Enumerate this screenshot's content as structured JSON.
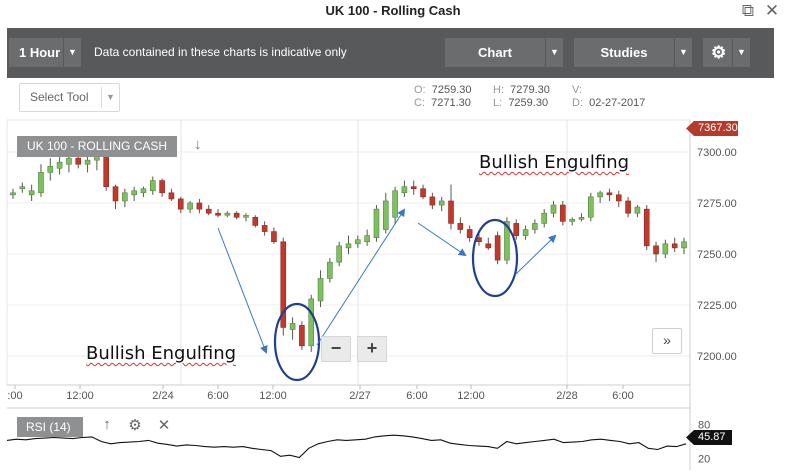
{
  "window": {
    "title": "UK 100 - Rolling Cash",
    "popout_icon": "popout-icon",
    "close_icon": "close-icon"
  },
  "toolbar": {
    "interval_label": "1 Hour",
    "notice": "Data contained in these charts is indicative only",
    "chart_label": "Chart",
    "studies_label": "Studies",
    "settings_icon": "gear-icon"
  },
  "select_tool": {
    "label": "Select Tool"
  },
  "ohlc": {
    "o_label": "O:",
    "o_value": "7259.30",
    "h_label": "H:",
    "h_value": "7279.30",
    "v_label": "V:",
    "v_value": "",
    "c_label": "C:",
    "c_value": "7271.30",
    "l_label": "L:",
    "l_value": "7259.30",
    "d_label": "D:",
    "d_value": "02-27-2017"
  },
  "instrument_label": "UK 100 - ROLLING CASH",
  "annotations": {
    "left": "Bullish Engulfing",
    "right": "Bullish Engulfing"
  },
  "zoom": {
    "minus": "−",
    "plus": "+"
  },
  "scroll_right": "»",
  "price_tag": "7367.30",
  "rsi": {
    "label": "RSI (14)",
    "value_tag": "45.87",
    "up_icon": "arrow-up-icon",
    "settings_icon": "gear-icon",
    "close_icon": "close-icon"
  },
  "colors": {
    "up": "#7fbf5f",
    "down": "#c0392b",
    "toolbar": "#58595b",
    "annotation": "#1f3f8f"
  },
  "chart_data": {
    "type": "candlestick",
    "title": "UK 100 - ROLLING CASH",
    "interval": "1 Hour",
    "y_ticks": [
      "7300.00",
      "7275.00",
      "7250.00",
      "7225.00",
      "7200.00"
    ],
    "ylim": [
      7190,
      7310
    ],
    "x_ticks": [
      ":00",
      "12:00",
      "2/24",
      "6:00",
      "12:00",
      "2/27",
      "6:00",
      "12:00",
      "2/28",
      "6:00"
    ],
    "candles": [
      {
        "o": 7279,
        "h": 7282,
        "l": 7277,
        "c": 7280
      },
      {
        "o": 7282,
        "h": 7285,
        "l": 7280,
        "c": 7283
      },
      {
        "o": 7279,
        "h": 7284,
        "l": 7276,
        "c": 7281
      },
      {
        "o": 7280,
        "h": 7294,
        "l": 7278,
        "c": 7290
      },
      {
        "o": 7290,
        "h": 7297,
        "l": 7286,
        "c": 7293
      },
      {
        "o": 7292,
        "h": 7298,
        "l": 7289,
        "c": 7295
      },
      {
        "o": 7294,
        "h": 7300,
        "l": 7290,
        "c": 7297
      },
      {
        "o": 7297,
        "h": 7302,
        "l": 7292,
        "c": 7294
      },
      {
        "o": 7294,
        "h": 7299,
        "l": 7290,
        "c": 7296
      },
      {
        "o": 7296,
        "h": 7306,
        "l": 7291,
        "c": 7300
      },
      {
        "o": 7300,
        "h": 7301,
        "l": 7281,
        "c": 7283
      },
      {
        "o": 7283,
        "h": 7284,
        "l": 7272,
        "c": 7276
      },
      {
        "o": 7276,
        "h": 7282,
        "l": 7273,
        "c": 7280
      },
      {
        "o": 7279,
        "h": 7283,
        "l": 7276,
        "c": 7281
      },
      {
        "o": 7280,
        "h": 7283,
        "l": 7278,
        "c": 7282
      },
      {
        "o": 7281,
        "h": 7288,
        "l": 7279,
        "c": 7286
      },
      {
        "o": 7286,
        "h": 7287,
        "l": 7278,
        "c": 7280
      },
      {
        "o": 7280,
        "h": 7282,
        "l": 7276,
        "c": 7277
      },
      {
        "o": 7277,
        "h": 7278,
        "l": 7270,
        "c": 7272
      },
      {
        "o": 7272,
        "h": 7276,
        "l": 7270,
        "c": 7275
      },
      {
        "o": 7275,
        "h": 7277,
        "l": 7270,
        "c": 7272
      },
      {
        "o": 7272,
        "h": 7274,
        "l": 7269,
        "c": 7270
      },
      {
        "o": 7270,
        "h": 7272,
        "l": 7268,
        "c": 7269
      },
      {
        "o": 7269,
        "h": 7271,
        "l": 7268,
        "c": 7270
      },
      {
        "o": 7270,
        "h": 7271,
        "l": 7267,
        "c": 7268
      },
      {
        "o": 7268,
        "h": 7270,
        "l": 7266,
        "c": 7269
      },
      {
        "o": 7268,
        "h": 7269,
        "l": 7263,
        "c": 7264
      },
      {
        "o": 7264,
        "h": 7266,
        "l": 7259,
        "c": 7261
      },
      {
        "o": 7261,
        "h": 7263,
        "l": 7255,
        "c": 7256
      },
      {
        "o": 7256,
        "h": 7258,
        "l": 7210,
        "c": 7214
      },
      {
        "o": 7213,
        "h": 7219,
        "l": 7208,
        "c": 7216
      },
      {
        "o": 7215,
        "h": 7217,
        "l": 7203,
        "c": 7205
      },
      {
        "o": 7205,
        "h": 7230,
        "l": 7202,
        "c": 7228
      },
      {
        "o": 7227,
        "h": 7242,
        "l": 7224,
        "c": 7238
      },
      {
        "o": 7238,
        "h": 7248,
        "l": 7236,
        "c": 7246
      },
      {
        "o": 7246,
        "h": 7256,
        "l": 7244,
        "c": 7254
      },
      {
        "o": 7253,
        "h": 7259,
        "l": 7250,
        "c": 7255
      },
      {
        "o": 7255,
        "h": 7259,
        "l": 7253,
        "c": 7257
      },
      {
        "o": 7256,
        "h": 7262,
        "l": 7254,
        "c": 7259
      },
      {
        "o": 7258,
        "h": 7274,
        "l": 7256,
        "c": 7272
      },
      {
        "o": 7262,
        "h": 7280,
        "l": 7260,
        "c": 7276
      },
      {
        "o": 7268,
        "h": 7283,
        "l": 7265,
        "c": 7281
      },
      {
        "o": 7280,
        "h": 7286,
        "l": 7278,
        "c": 7283
      },
      {
        "o": 7283,
        "h": 7286,
        "l": 7279,
        "c": 7282
      },
      {
        "o": 7282,
        "h": 7284,
        "l": 7277,
        "c": 7278
      },
      {
        "o": 7278,
        "h": 7280,
        "l": 7272,
        "c": 7274
      },
      {
        "o": 7274,
        "h": 7278,
        "l": 7271,
        "c": 7276
      },
      {
        "o": 7276,
        "h": 7284,
        "l": 7262,
        "c": 7265
      },
      {
        "o": 7265,
        "h": 7268,
        "l": 7260,
        "c": 7262
      },
      {
        "o": 7262,
        "h": 7264,
        "l": 7256,
        "c": 7258
      },
      {
        "o": 7258,
        "h": 7260,
        "l": 7254,
        "c": 7256
      },
      {
        "o": 7255,
        "h": 7258,
        "l": 7252,
        "c": 7253
      },
      {
        "o": 7259,
        "h": 7261,
        "l": 7245,
        "c": 7247
      },
      {
        "o": 7247,
        "h": 7268,
        "l": 7245,
        "c": 7266
      },
      {
        "o": 7265,
        "h": 7267,
        "l": 7257,
        "c": 7259
      },
      {
        "o": 7259,
        "h": 7264,
        "l": 7257,
        "c": 7262
      },
      {
        "o": 7262,
        "h": 7267,
        "l": 7260,
        "c": 7265
      },
      {
        "o": 7265,
        "h": 7272,
        "l": 7263,
        "c": 7270
      },
      {
        "o": 7270,
        "h": 7276,
        "l": 7268,
        "c": 7274
      },
      {
        "o": 7274,
        "h": 7276,
        "l": 7264,
        "c": 7266
      },
      {
        "o": 7266,
        "h": 7268,
        "l": 7264,
        "c": 7267
      },
      {
        "o": 7267,
        "h": 7270,
        "l": 7266,
        "c": 7268
      },
      {
        "o": 7268,
        "h": 7280,
        "l": 7266,
        "c": 7278
      },
      {
        "o": 7278,
        "h": 7281,
        "l": 7275,
        "c": 7280
      },
      {
        "o": 7280,
        "h": 7282,
        "l": 7276,
        "c": 7279
      },
      {
        "o": 7279,
        "h": 7281,
        "l": 7273,
        "c": 7276
      },
      {
        "o": 7276,
        "h": 7278,
        "l": 7268,
        "c": 7270
      },
      {
        "o": 7270,
        "h": 7274,
        "l": 7268,
        "c": 7273
      },
      {
        "o": 7272,
        "h": 7274,
        "l": 7252,
        "c": 7254
      },
      {
        "o": 7254,
        "h": 7256,
        "l": 7246,
        "c": 7250
      },
      {
        "o": 7250,
        "h": 7257,
        "l": 7248,
        "c": 7255
      },
      {
        "o": 7255,
        "h": 7258,
        "l": 7251,
        "c": 7253
      },
      {
        "o": 7253,
        "h": 7258,
        "l": 7250,
        "c": 7256
      }
    ],
    "rsi": {
      "ylim": [
        0,
        100
      ],
      "ticks": [
        "80",
        "20"
      ],
      "values": [
        52,
        54,
        53,
        55,
        56,
        57,
        56,
        55,
        57,
        58,
        50,
        46,
        48,
        49,
        50,
        52,
        47,
        45,
        42,
        44,
        43,
        41,
        40,
        41,
        40,
        41,
        38,
        36,
        34,
        24,
        26,
        22,
        38,
        46,
        50,
        53,
        52,
        53,
        54,
        58,
        60,
        61,
        60,
        58,
        55,
        52,
        53,
        47,
        45,
        43,
        42,
        41,
        38,
        50,
        46,
        48,
        50,
        52,
        54,
        48,
        49,
        50,
        53,
        54,
        52,
        50,
        46,
        48,
        38,
        36,
        42,
        41,
        46
      ]
    }
  }
}
